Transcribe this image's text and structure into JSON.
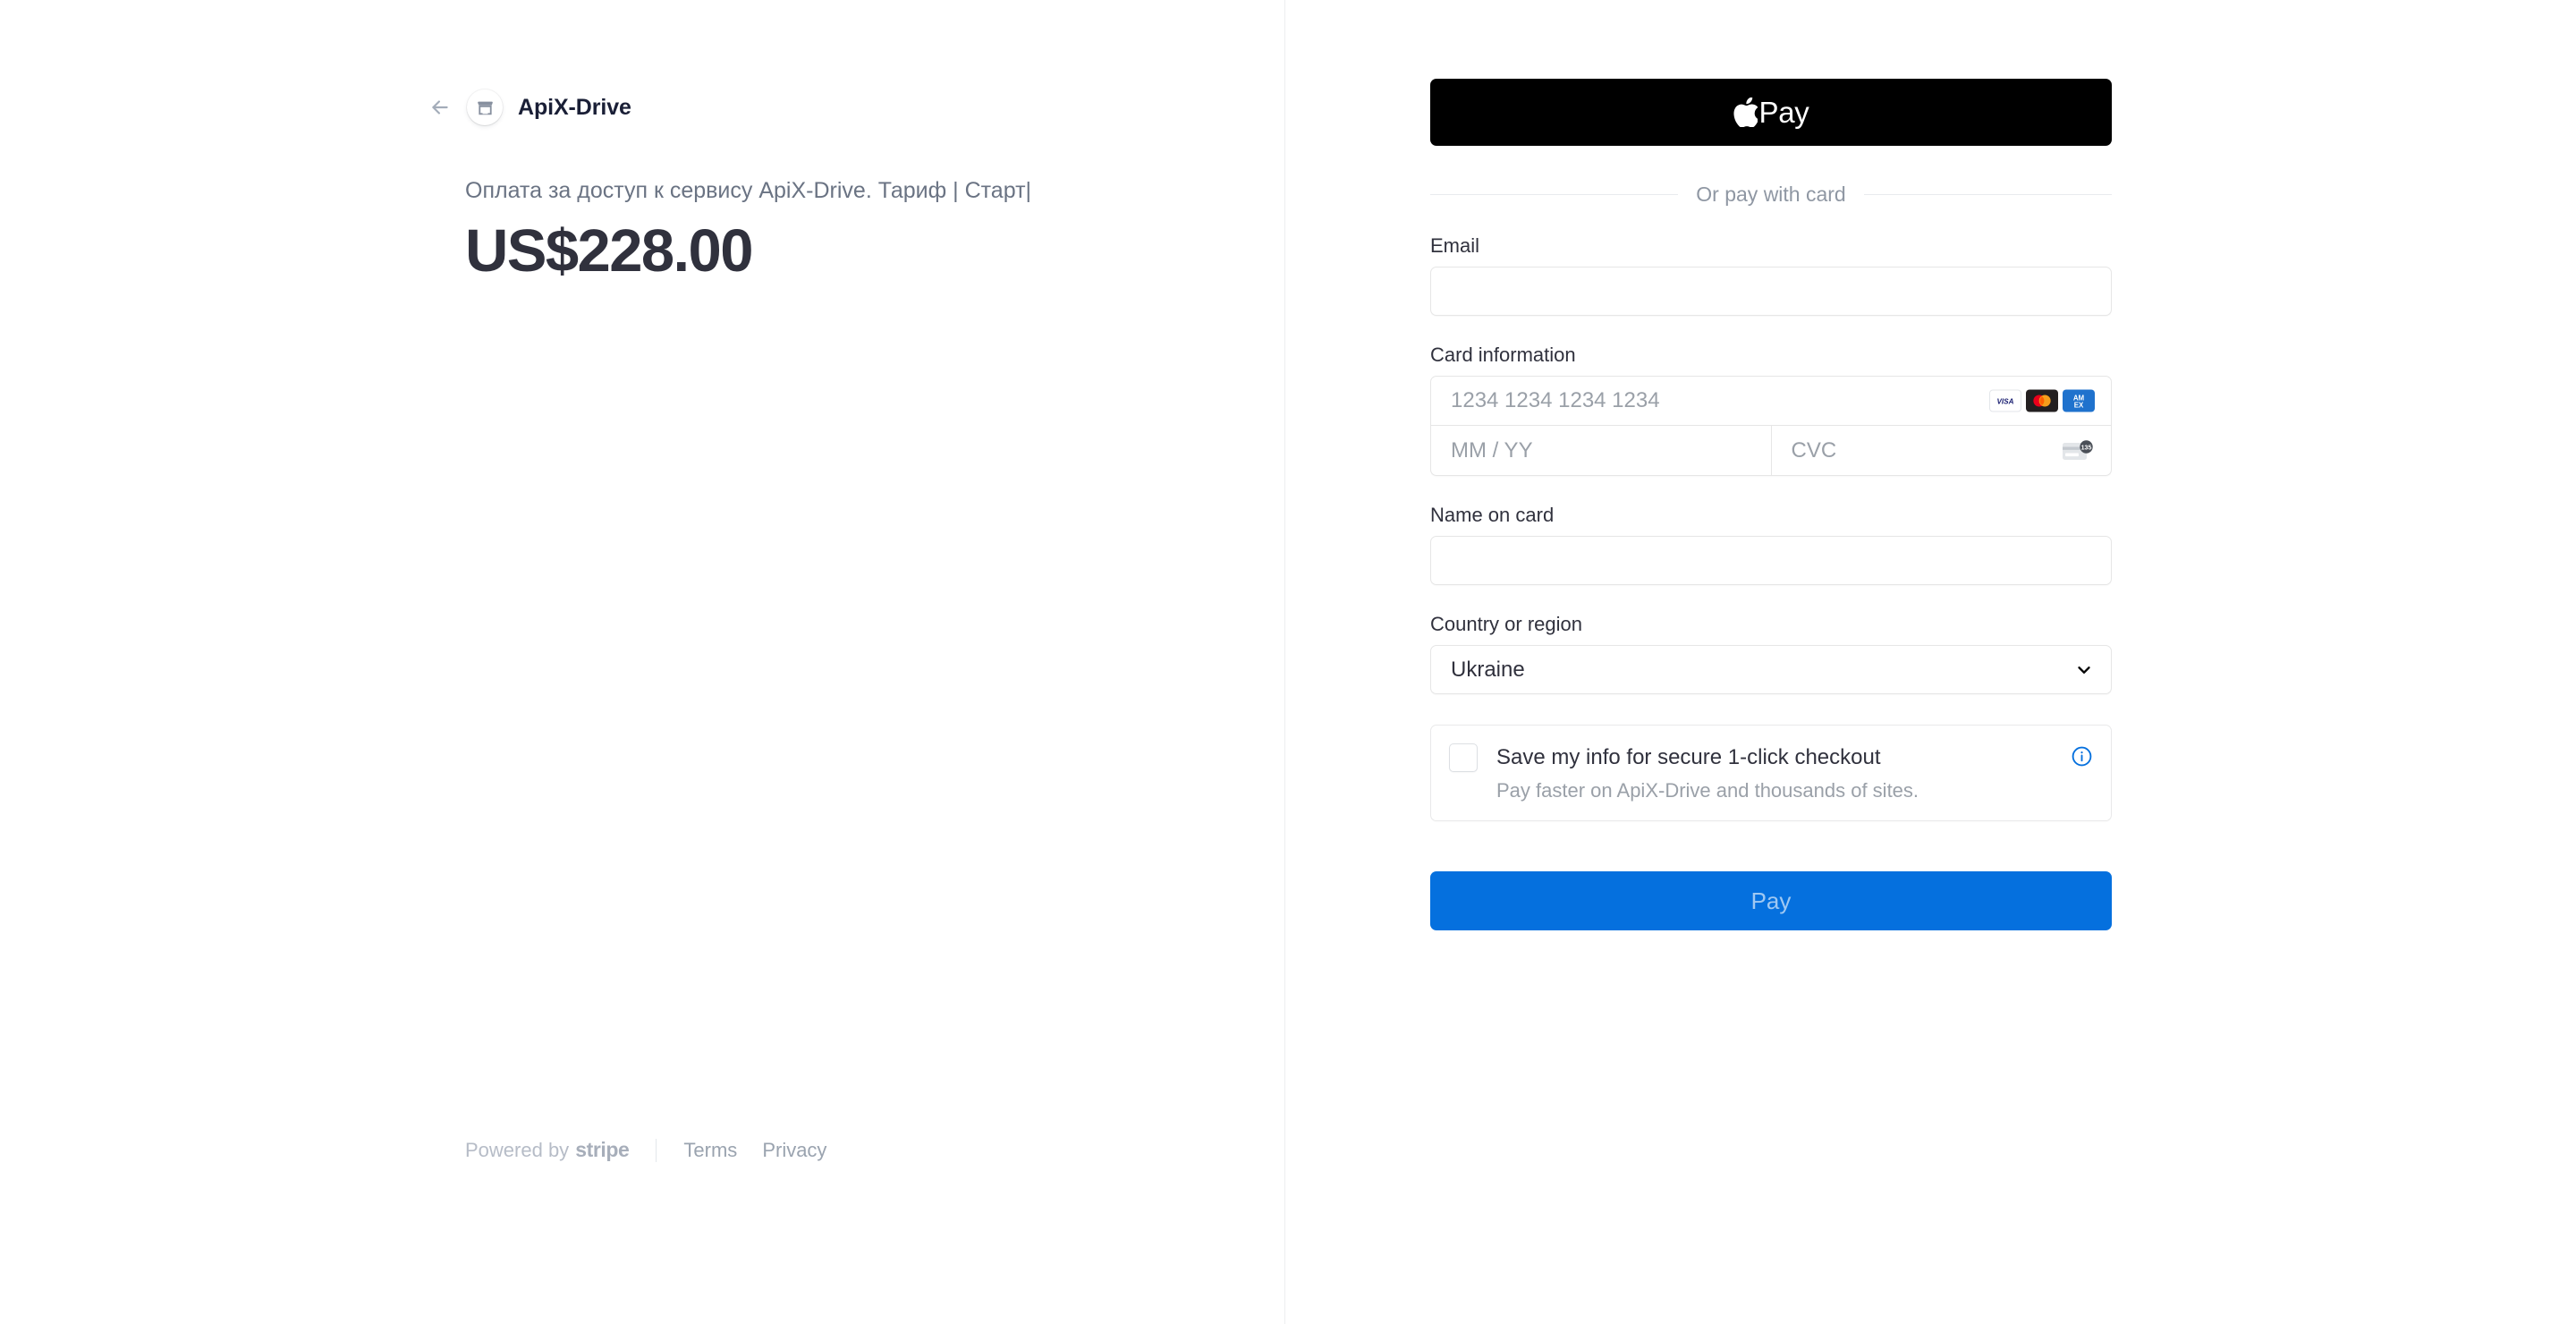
{
  "merchant": {
    "back_label": "Back",
    "icon": "store-icon",
    "name": "ApiX-Drive"
  },
  "order": {
    "description": "Оплата за доступ к сервису ApiX-Drive. Тариф | Старт|",
    "amount": "US$228.00"
  },
  "footer": {
    "powered_prefix": "Powered by",
    "stripe": "stripe",
    "terms": "Terms",
    "privacy": "Privacy"
  },
  "wallet": {
    "apple_pay_label": "Pay",
    "apple_icon": "apple-logo-icon"
  },
  "divider": {
    "text": "Or pay with card"
  },
  "form": {
    "email": {
      "label": "Email",
      "value": "",
      "placeholder": ""
    },
    "card_information": {
      "label": "Card information",
      "number": {
        "value": "",
        "placeholder": "1234 1234 1234 1234"
      },
      "expiry": {
        "value": "",
        "placeholder": "MM / YY"
      },
      "cvc": {
        "value": "",
        "placeholder": "CVC",
        "icon": "cvc-card-icon",
        "icon_digits": "135"
      },
      "brands": [
        {
          "name": "visa-icon",
          "label": "VISA",
          "bg": "#ffffff",
          "fg": "#1a1f71"
        },
        {
          "name": "mastercard-icon",
          "label": "",
          "bg": "#231f20",
          "fg": "#eb001b"
        },
        {
          "name": "amex-icon",
          "label": "AMEX",
          "bg": "#1f72cd",
          "fg": "#ffffff"
        }
      ]
    },
    "name_on_card": {
      "label": "Name on card",
      "value": "",
      "placeholder": ""
    },
    "country": {
      "label": "Country or region",
      "value": "Ukraine",
      "options": [
        "Ukraine"
      ],
      "chevron": "chevron-down-icon"
    },
    "save_info": {
      "checked": false,
      "title": "Save my info for secure 1-click checkout",
      "subtitle": "Pay faster on ApiX-Drive and thousands of sites.",
      "info_icon": "info-circle-icon"
    },
    "submit_label": "Pay"
  },
  "colors": {
    "accent": "#0570de",
    "apple_pay_bg": "#000000",
    "text_primary": "#30313d",
    "text_muted": "#6a7383",
    "border": "#e6e6e6"
  }
}
